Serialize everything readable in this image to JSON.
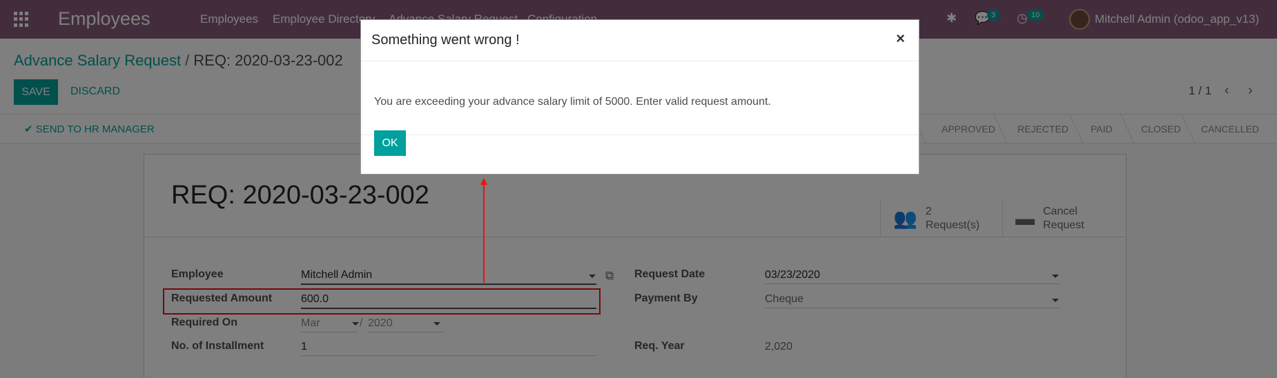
{
  "navbar": {
    "brand": "Employees",
    "menu": [
      "Employees",
      "Employee Directory",
      "Advance Salary Request",
      "Configuration"
    ],
    "chat_count": "3",
    "activity_count": "10",
    "user": "Mitchell Admin (odoo_app_v13)"
  },
  "breadcrumb": {
    "parent": "Advance Salary Request",
    "separator": "/",
    "current": "REQ: 2020-03-23-002"
  },
  "buttons": {
    "save": "SAVE",
    "discard": "DISCARD"
  },
  "pager": {
    "text": "1 / 1"
  },
  "statusbar": {
    "action": "SEND TO HR MANAGER",
    "stages": [
      "APPROVED",
      "REJECTED",
      "PAID",
      "CLOSED",
      "CANCELLED"
    ]
  },
  "form": {
    "title": "REQ: 2020-03-23-002",
    "smart_buttons": [
      {
        "line1": "2",
        "line2": "Request(s)",
        "icon": "users-icon"
      },
      {
        "line1": "Cancel",
        "line2": "Request",
        "icon": "archive-icon"
      }
    ],
    "fields": {
      "employee_label": "Employee",
      "employee_value": "Mitchell Admin",
      "requested_amount_label": "Requested Amount",
      "requested_amount_value": "600.0",
      "required_on_label": "Required On",
      "required_on_month": "Mar",
      "required_on_sep": "/",
      "required_on_year": "2020",
      "installment_label": "No. of Installment",
      "installment_value": "1",
      "request_date_label": "Request Date",
      "request_date_value": "03/23/2020",
      "payment_by_label": "Payment By",
      "payment_by_value": "Cheque",
      "req_year_label": "Req. Year",
      "req_year_value": "2,020"
    }
  },
  "dialog": {
    "title": "Something went wrong !",
    "close": "×",
    "message": "You are exceeding your advance salary limit of 5000. Enter valid request amount.",
    "ok": "OK"
  },
  "colors": {
    "navbar": "#875a7b",
    "accent": "#00a09d",
    "annotation": "#e11"
  }
}
